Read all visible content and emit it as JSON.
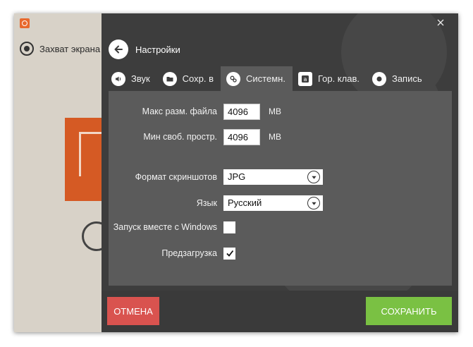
{
  "background_app": {
    "capture_label": "Захват экрана"
  },
  "header": {
    "title": "Настройки"
  },
  "tabs": [
    {
      "label": "Звук",
      "icon": "speaker-icon"
    },
    {
      "label": "Сохр. в",
      "icon": "folder-icon"
    },
    {
      "label": "Системн.",
      "icon": "gears-icon",
      "active": true
    },
    {
      "label": "Гор. клав.",
      "icon": "keyboard-a-icon"
    },
    {
      "label": "Запись",
      "icon": "record-icon"
    }
  ],
  "settings": {
    "max_file_size": {
      "label": "Макс разм. файла",
      "value": "4096",
      "unit": "MB"
    },
    "min_free_space": {
      "label": "Мин своб. простр.",
      "value": "4096",
      "unit": "MB"
    },
    "screenshot_format": {
      "label": "Формат скриншотов",
      "value": "JPG"
    },
    "language": {
      "label": "Язык",
      "value": "Русский"
    },
    "start_with_windows": {
      "label": "Запуск вместе с Windows",
      "checked": false
    },
    "preload": {
      "label": "Предзагрузка",
      "checked": true
    }
  },
  "footer": {
    "cancel_label": "ОТМЕНА",
    "save_label": "СОХРАНИТЬ"
  },
  "colors": {
    "dialog_bg": "#3d3d3d",
    "panel_bg": "#5b5b5b",
    "cancel": "#d9534f",
    "save": "#7ac143",
    "accent_orange": "#e8692d"
  }
}
